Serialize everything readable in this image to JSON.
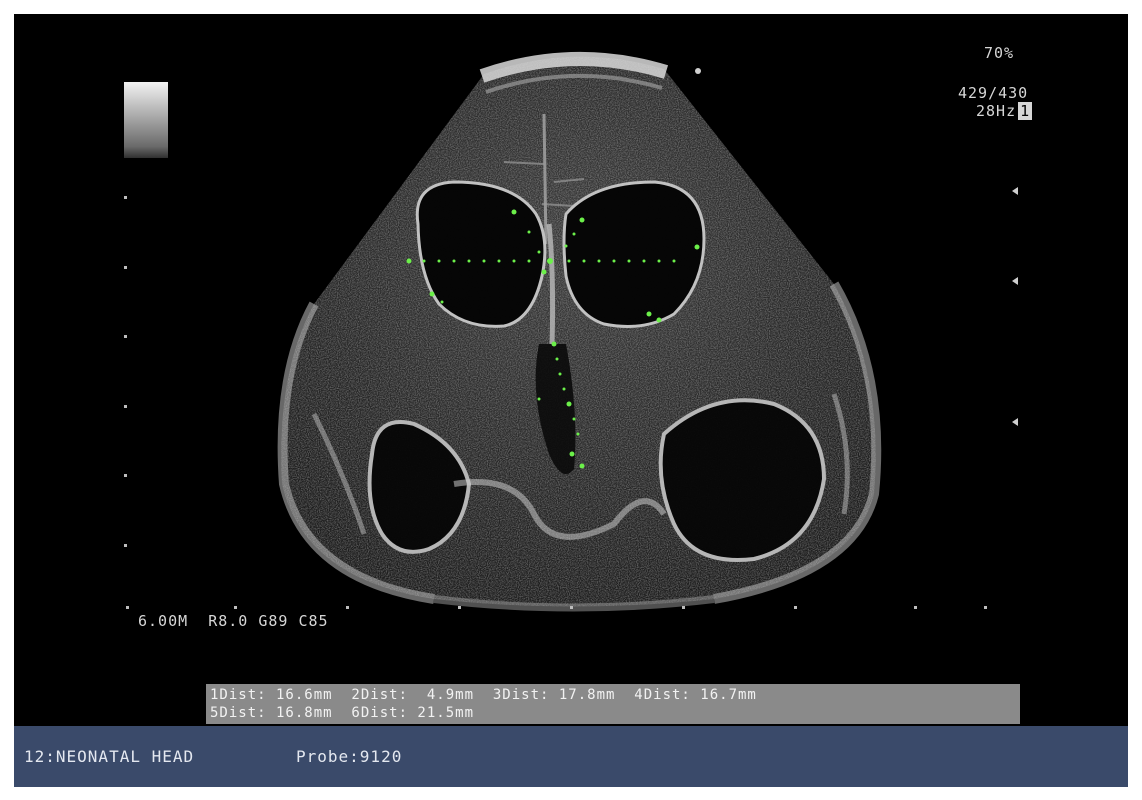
{
  "screen": {
    "zoom": "70%",
    "depth_frames": "429/430",
    "frequency": "28Hz",
    "frequency_mode": "1",
    "depth_settings": "6.00M  R8.0 G89 C85"
  },
  "measurements": {
    "row1": "1Dist: 16.6mm  2Dist:  4.9mm  3Dist: 17.8mm  4Dist: 16.7mm",
    "row2": "5Dist: 16.8mm  6Dist: 21.5mm"
  },
  "status_bar": {
    "preset": "12:NEONATAL HEAD",
    "probe": "Probe:9120"
  },
  "colors": {
    "background": "#000000",
    "caliper": "#6cf04a",
    "measurement_panel": "#8a8a8a",
    "status_bar": "#3a4a6a"
  }
}
